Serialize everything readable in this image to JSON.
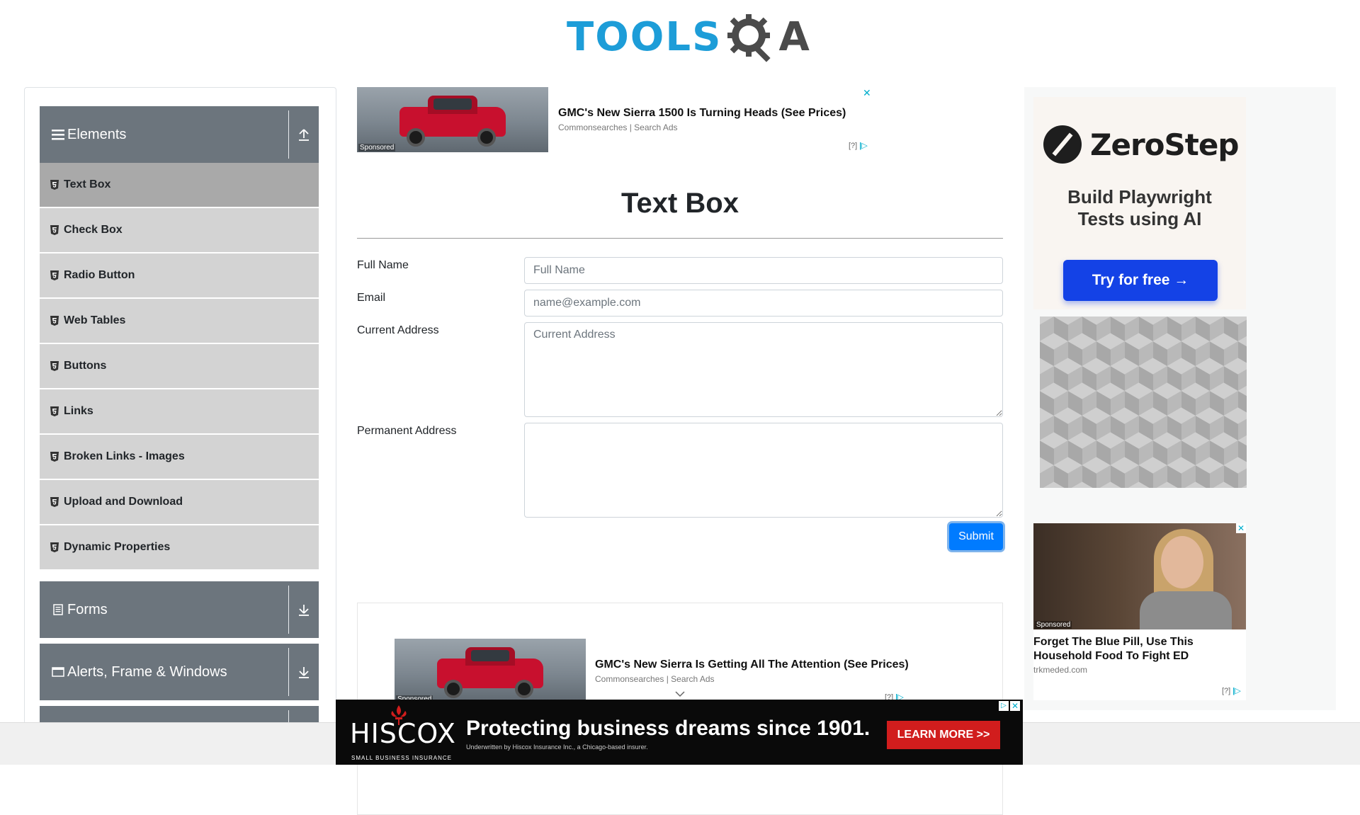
{
  "header": {
    "logo_left": "TOOLS",
    "logo_right": "A",
    "gear_icon": "gear-magnifier-icon"
  },
  "sidebar": {
    "groups": [
      {
        "label": "Elements",
        "icon": "hamburger-icon",
        "toggle": "collapse-up-icon",
        "expanded": true
      },
      {
        "label": "Forms",
        "icon": "document-icon",
        "toggle": "expand-down-icon",
        "expanded": false
      },
      {
        "label": "Alerts, Frame & Windows",
        "icon": "window-icon",
        "toggle": "expand-down-icon",
        "expanded": false
      }
    ],
    "items": [
      {
        "label": "Text Box",
        "active": true
      },
      {
        "label": "Check Box"
      },
      {
        "label": "Radio Button"
      },
      {
        "label": "Web Tables"
      },
      {
        "label": "Buttons"
      },
      {
        "label": "Links"
      },
      {
        "label": "Broken Links - Images"
      },
      {
        "label": "Upload and Download"
      },
      {
        "label": "Dynamic Properties"
      }
    ]
  },
  "ad_top": {
    "title": "GMC's New Sierra 1500 Is Turning Heads (See Prices)",
    "source": "Commonsearches | Search Ads",
    "sponsored": "Sponsored",
    "choice": "[?]",
    "close": "✕"
  },
  "form": {
    "title": "Text Box",
    "full_name_label": "Full Name",
    "full_name_placeholder": "Full Name",
    "email_label": "Email",
    "email_placeholder": "name@example.com",
    "current_address_label": "Current Address",
    "current_address_placeholder": "Current Address",
    "permanent_address_label": "Permanent Address",
    "submit_label": "Submit"
  },
  "ad_mid": {
    "title": "GMC's New Sierra Is Getting All The Attention (See Prices)",
    "source": "Commonsearches | Search Ads",
    "sponsored": "Sponsored",
    "choice": "[?]"
  },
  "zerostep": {
    "name": "ZeroStep",
    "tagline_1": "Build Playwright",
    "tagline_2": "Tests using AI",
    "cta": "Try for free →"
  },
  "ad_side": {
    "title": "Forget The Blue Pill, Use This Household Food To Fight ED",
    "source": "trkmeded.com",
    "sponsored": "Sponsored",
    "choice": "[?]"
  },
  "banner": {
    "brand": "HISCOX",
    "brand_sub": "SMALL BUSINESS INSURANCE",
    "headline": "Protecting business dreams since 1901.",
    "subline": "Underwritten by Hiscox Insurance Inc., a Chicago-based insurer.",
    "cta": "LEARN MORE >>"
  },
  "colors": {
    "accent": "#007bff",
    "sidebar_header": "#6c757d",
    "sidebar_item": "#d3d3d3",
    "sidebar_active": "#a9a9a9",
    "logo_blue": "#1d9dd8"
  }
}
